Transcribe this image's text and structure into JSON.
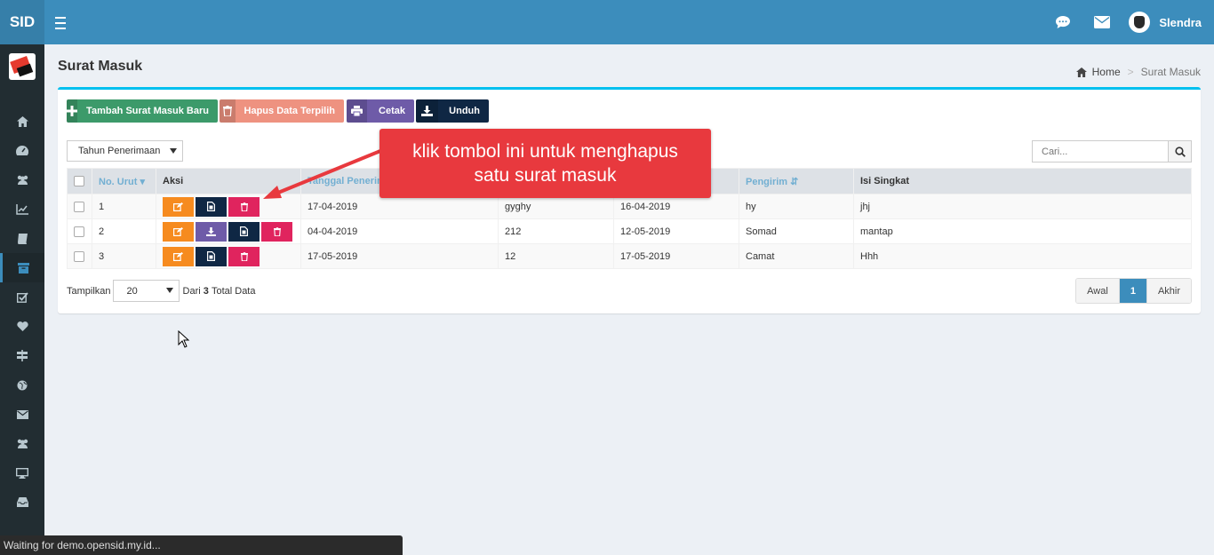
{
  "app": {
    "logo": "SID"
  },
  "header": {
    "user_name": "Slendra"
  },
  "page": {
    "title": "Surat Masuk"
  },
  "breadcrumb": {
    "home": "Home",
    "separator": ">",
    "current": "Surat Masuk"
  },
  "toolbar": {
    "add_label": "Tambah Surat Masuk Baru",
    "delete_selected_label": "Hapus Data Terpilih",
    "print_label": "Cetak",
    "download_label": "Unduh"
  },
  "filter": {
    "year_select": "Tahun Penerimaan"
  },
  "search": {
    "placeholder": "Cari..."
  },
  "table": {
    "headers": {
      "no": "No. Urut",
      "aksi": "Aksi",
      "tanggal": "Tanggal Penerim",
      "col4": "",
      "col5": "",
      "pengirim": "Pengirim",
      "isi": "Isi Singkat"
    },
    "rows": [
      {
        "no": "1",
        "tanggal": "17-04-2019",
        "nomor": "gyghy",
        "tgl_surat": "16-04-2019",
        "pengirim": "hy",
        "isi": "jhj"
      },
      {
        "no": "2",
        "tanggal": "04-04-2019",
        "nomor": "212",
        "tgl_surat": "12-05-2019",
        "pengirim": "Somad",
        "isi": "mantap"
      },
      {
        "no": "3",
        "tanggal": "17-05-2019",
        "nomor": "12",
        "tgl_surat": "17-05-2019",
        "pengirim": "Camat",
        "isi": "Hhh"
      }
    ]
  },
  "footer": {
    "show_label": "Tampilkan",
    "page_size": "20",
    "from_label": "Dari",
    "total": "3",
    "total_label": "Total Data"
  },
  "pagination": {
    "first": "Awal",
    "current": "1",
    "last": "Akhir"
  },
  "callout": {
    "line1": "klik tombol ini untuk menghapus",
    "line2": "satu surat masuk"
  },
  "status_bar": {
    "text": "Waiting for demo.opensid.my.id..."
  },
  "colors": {
    "header": "#3c8dbc",
    "sidebar": "#222d32",
    "btn_add": "#3c9a6a",
    "btn_delete": "#ee9280",
    "btn_print": "#6e5ba8",
    "btn_download": "#0f2744",
    "act_edit": "#f68b1f",
    "act_doc": "#0f2744",
    "act_delete": "#e0245e",
    "act_download": "#6e5ba8",
    "callout": "#e8393e"
  },
  "icons": [
    "menu-icon",
    "comments-icon",
    "envelope-icon",
    "home-icon",
    "dashboard-icon",
    "users-icon",
    "chart-icon",
    "book-icon",
    "archive-icon",
    "check-icon",
    "heart-icon",
    "signpost-icon",
    "globe-icon",
    "mail-icon",
    "group-icon",
    "monitor-icon",
    "inbox-icon",
    "plus-icon",
    "trash-icon",
    "print-icon",
    "download-icon",
    "search-icon",
    "edit-icon",
    "file-icon"
  ]
}
